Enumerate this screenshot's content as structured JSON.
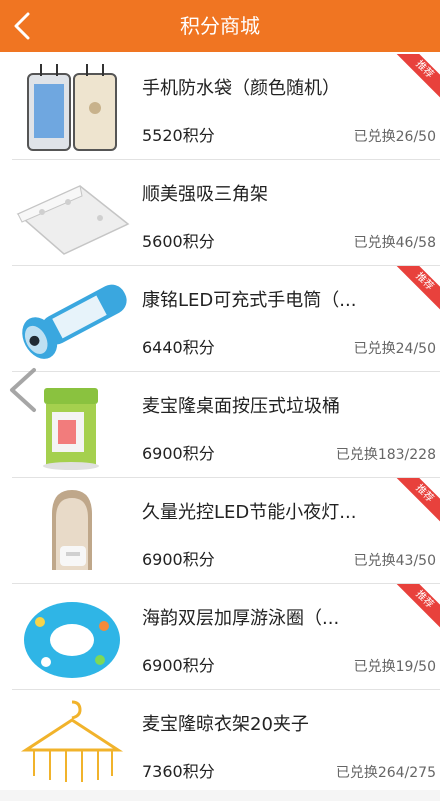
{
  "header": {
    "title": "积分商城"
  },
  "colors": {
    "brand": "#f07522",
    "ribbon": "#e8413c"
  },
  "items": [
    {
      "name": "手机防水袋（颜色随机）",
      "points": "5520积分",
      "count": "已兑换26/50",
      "badge": "推荐"
    },
    {
      "name": "顺美强吸三角架",
      "points": "5600积分",
      "count": "已兑换46/58",
      "badge": ""
    },
    {
      "name": "康铭LED可充式手电筒（...",
      "points": "6440积分",
      "count": "已兑换24/50",
      "badge": "推荐"
    },
    {
      "name": "麦宝隆桌面按压式垃圾桶",
      "points": "6900积分",
      "count": "已兑换183/228",
      "badge": ""
    },
    {
      "name": "久量光控LED节能小夜灯...",
      "points": "6900积分",
      "count": "已兑换43/50",
      "badge": "推荐"
    },
    {
      "name": "海韵双层加厚游泳圈（...",
      "points": "6900积分",
      "count": "已兑换19/50",
      "badge": "推荐"
    },
    {
      "name": "麦宝隆晾衣架20夹子",
      "points": "7360积分",
      "count": "已兑换264/275",
      "badge": ""
    }
  ]
}
